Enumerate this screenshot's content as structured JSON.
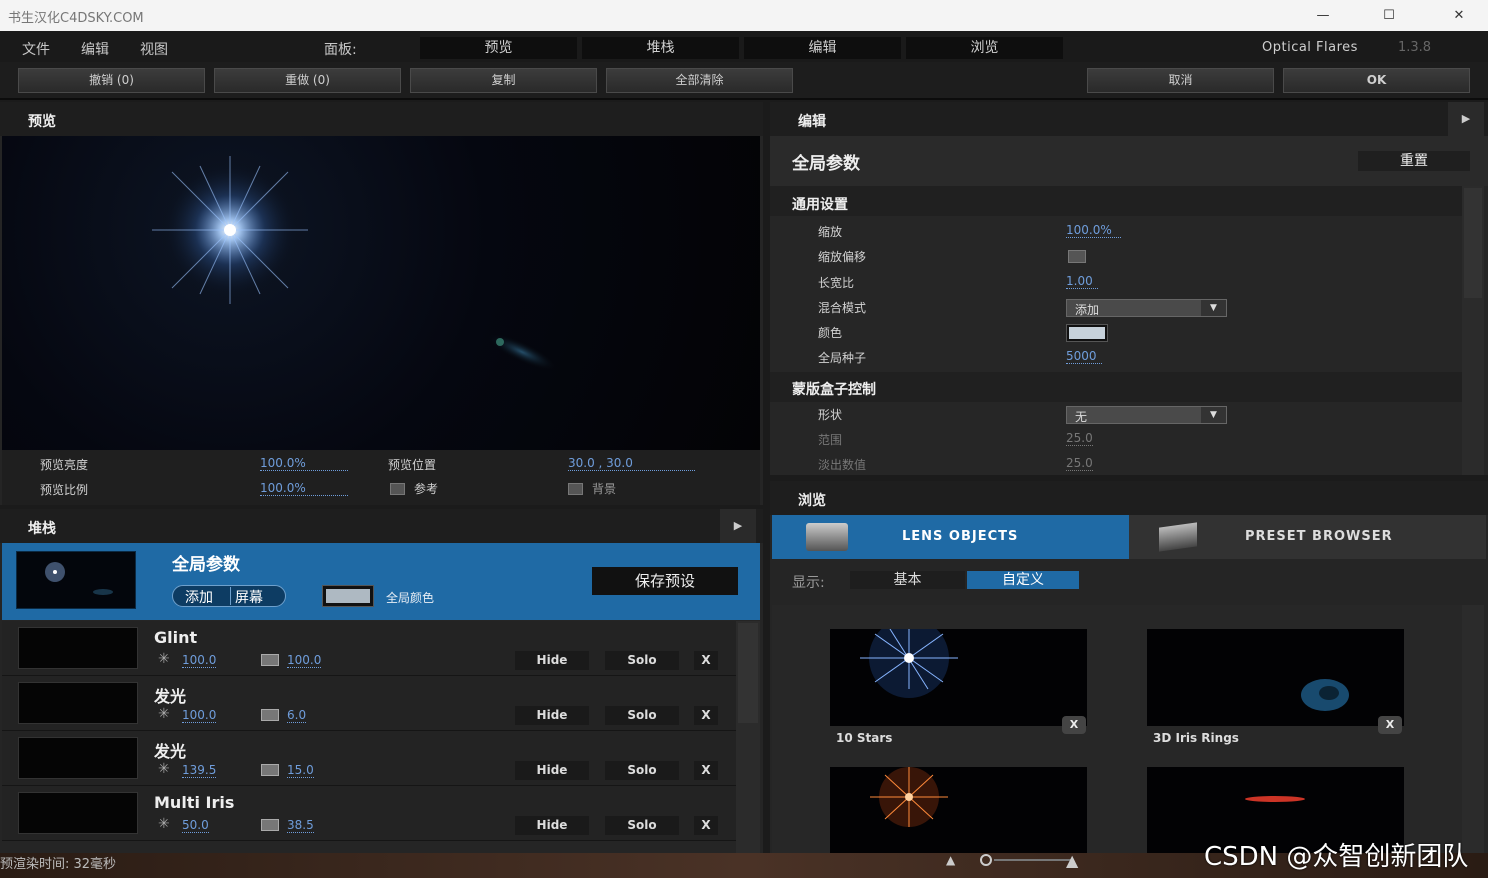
{
  "window": {
    "title": "书生汉化C4DSKY.COM",
    "minimize_icon": "—",
    "maximize_icon": "☐",
    "close_icon": "✕"
  },
  "menu": {
    "items": [
      "文件",
      "编辑",
      "视图"
    ],
    "panel_label": "面板:",
    "panel_tabs": [
      "预览",
      "堆栈",
      "编辑",
      "浏览"
    ],
    "app_name": "Optical Flares",
    "version": "1.3.8"
  },
  "toolbar": {
    "undo": "撤销 (0)",
    "redo": "重做 (0)",
    "copy": "复制",
    "clear_all": "全部清除",
    "cancel": "取消",
    "ok": "OK"
  },
  "preview": {
    "header": "预览",
    "brightness_label": "预览亮度",
    "brightness_value": "100.0%",
    "position_label": "预览位置",
    "position_value": "30.0 , 30.0",
    "scale_label": "预览比例",
    "scale_value": "100.0%",
    "reference_label": "参考",
    "background_label": "背景"
  },
  "stack": {
    "header": "堆栈",
    "global": {
      "title": "全局参数",
      "add_label": "添加",
      "screen_label": "屏幕",
      "global_color_label": "全局颜色",
      "save_preset": "保存预设"
    },
    "rows": [
      {
        "name": "Glint",
        "brightness": "100.0",
        "scale": "100.0"
      },
      {
        "name": "发光",
        "brightness": "100.0",
        "scale": "6.0"
      },
      {
        "name": "发光",
        "brightness": "139.5",
        "scale": "15.0"
      },
      {
        "name": "Multi Iris",
        "brightness": "50.0",
        "scale": "38.5"
      }
    ],
    "hide_label": "Hide",
    "solo_label": "Solo",
    "delete_label": "X"
  },
  "editor": {
    "header": "编辑",
    "section_title": "全局参数",
    "reset_label": "重置",
    "general_title": "通用设置",
    "general": [
      {
        "label": "缩放",
        "value": "100.0%"
      },
      {
        "label": "缩放偏移",
        "value": ""
      },
      {
        "label": "长宽比",
        "value": "1.00"
      },
      {
        "label": "混合模式",
        "value": "添加"
      },
      {
        "label": "颜色",
        "value": ""
      },
      {
        "label": "全局种子",
        "value": "5000"
      }
    ],
    "mask_title": "蒙版盒子控制",
    "mask": [
      {
        "label": "形状",
        "value": "无"
      },
      {
        "label": "范围",
        "value": "25.0"
      },
      {
        "label": "淡出数值",
        "value": "25.0"
      }
    ]
  },
  "browser": {
    "header": "浏览",
    "tab_lens": "LENS OBJECTS",
    "tab_preset": "PRESET BROWSER",
    "show_label": "显示:",
    "filter_basic": "基本",
    "filter_custom": "自定义",
    "presets": [
      {
        "name": "10 Stars"
      },
      {
        "name": "3D Iris Rings"
      },
      {
        "name": ""
      },
      {
        "name": ""
      }
    ]
  },
  "status": {
    "render_time": "预渲染时间: 32毫秒"
  },
  "watermark": "CSDN @众智创新团队",
  "colors": {
    "accent_blue": "#1f6aa5",
    "value_blue": "#6f9ddb",
    "panel_bg": "#252525"
  }
}
